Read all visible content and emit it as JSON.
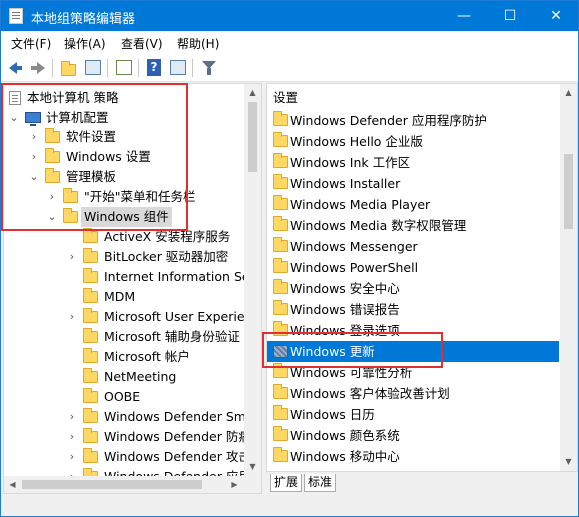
{
  "window": {
    "title": "本地组策略编辑器",
    "minimize": "—",
    "maximize": "☐",
    "close": "✕"
  },
  "menu": {
    "items": [
      "文件(F)",
      "操作(A)",
      "查看(V)",
      "帮助(H)"
    ]
  },
  "toolbar": {
    "buttons": [
      "back-icon",
      "forward-icon",
      "folder-up-icon",
      "show-hide-tree-icon",
      "export-list-icon",
      "help-icon",
      "properties-icon",
      "filter-icon"
    ]
  },
  "tree": {
    "root": "本地计算机 策略",
    "computer_config": "计算机配置",
    "software_settings": "软件设置",
    "windows_settings": "Windows 设置",
    "admin_templates": "管理模板",
    "start_menu": "\"开始\"菜单和任务栏",
    "windows_components": "Windows 组件",
    "children": [
      "ActiveX 安装程序服务",
      "BitLocker 驱动器加密",
      "Internet Information Ser",
      "MDM",
      "Microsoft User Experien",
      "Microsoft 辅助身份验证",
      "Microsoft 帐户",
      "NetMeeting",
      "OOBE",
      "Windows Defender Sma",
      "Windows Defender 防病",
      "Windows Defender 攻击",
      "Windows Defender 应用"
    ]
  },
  "list": {
    "header": "设置",
    "items": [
      "Windows Defender 应用程序防护",
      "Windows Hello 企业版",
      "Windows Ink 工作区",
      "Windows Installer",
      "Windows Media Player",
      "Windows Media 数字权限管理",
      "Windows Messenger",
      "Windows PowerShell",
      "Windows 安全中心",
      "Windows 错误报告",
      "Windows 登录选项",
      "Windows 更新",
      "Windows 可靠性分析",
      "Windows 客户体验改善计划",
      "Windows 日历",
      "Windows 颜色系统",
      "Windows 移动中心"
    ],
    "selected": "Windows 更新"
  },
  "tabs": {
    "extended": "扩展",
    "standard": "标准"
  },
  "colors": {
    "titlebar": "#0078d7",
    "selection": "#0078d7",
    "annotation": "#e03030"
  }
}
